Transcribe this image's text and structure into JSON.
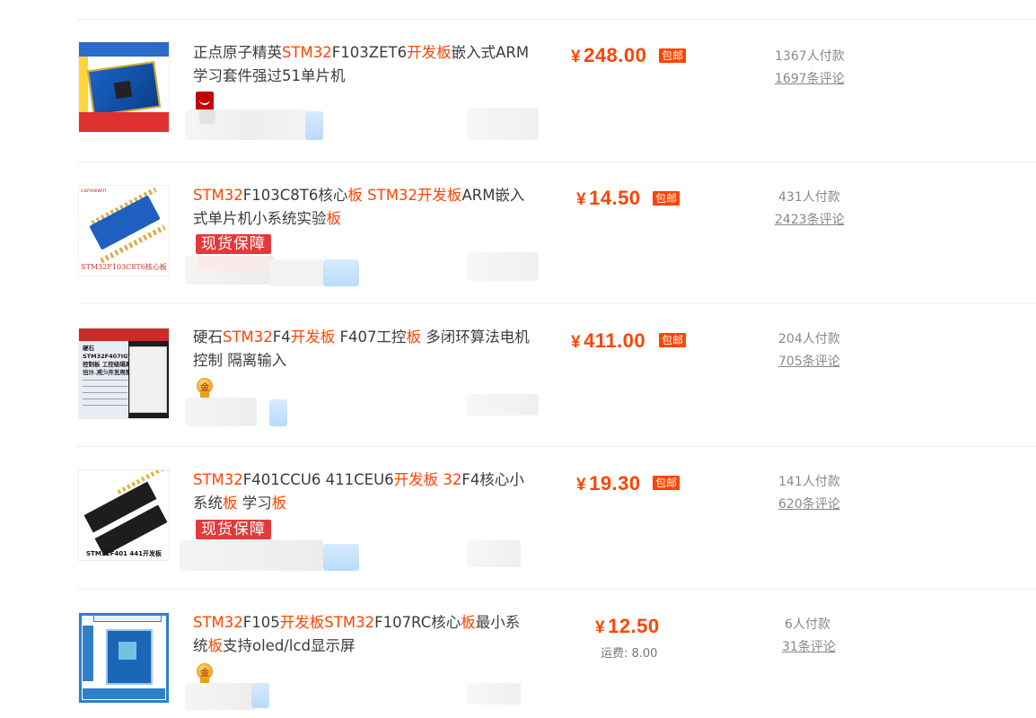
{
  "products": [
    {
      "title_segments": [
        {
          "text": "正点原子精英",
          "hl": false
        },
        {
          "text": "STM32",
          "hl": true
        },
        {
          "text": "F103ZET6",
          "hl": false
        },
        {
          "text": "开发板",
          "hl": true
        },
        {
          "text": "嵌入式ARM学习套件强过51单片机",
          "hl": false
        }
      ],
      "price_symbol": "¥",
      "price": "248.00",
      "free_shipping": "包邮",
      "shipping_fee": null,
      "paid_count": "1367人付款",
      "reviews": "1697条评论",
      "badge": "tmall"
    },
    {
      "title_segments": [
        {
          "text": "STM32",
          "hl": true
        },
        {
          "text": "F103C8T6核心",
          "hl": false
        },
        {
          "text": "板",
          "hl": true
        },
        {
          "text": " ",
          "hl": false
        },
        {
          "text": "STM32开发板",
          "hl": true
        },
        {
          "text": "ARM嵌入式单片机小系统实验",
          "hl": false
        },
        {
          "text": "板",
          "hl": true
        }
      ],
      "price_symbol": "¥",
      "price": "14.50",
      "free_shipping": "包邮",
      "shipping_fee": null,
      "paid_count": "431人付款",
      "reviews": "2423条评论",
      "badge": "现货保障",
      "thumb_caption": "STM32F103C8T6核心板"
    },
    {
      "title_segments": [
        {
          "text": "硬石",
          "hl": false
        },
        {
          "text": "STM32",
          "hl": true
        },
        {
          "text": "F4",
          "hl": false
        },
        {
          "text": "开发板",
          "hl": true
        },
        {
          "text": " F407工控",
          "hl": false
        },
        {
          "text": "板",
          "hl": true
        },
        {
          "text": " 多闭环算法电机控制 隔离输入",
          "hl": false
        }
      ],
      "price_symbol": "¥",
      "price": "411.00",
      "free_shipping": "包邮",
      "shipping_fee": null,
      "paid_count": "204人付款",
      "reviews": "705条评论",
      "badge": "medal",
      "thumb_text": "硬石STM32F407IGT6控制板 工控级隔离设计 减少开发周期"
    },
    {
      "title_segments": [
        {
          "text": "STM32",
          "hl": true
        },
        {
          "text": "F401CCU6 411CEU6",
          "hl": false
        },
        {
          "text": "开发板",
          "hl": true
        },
        {
          "text": " ",
          "hl": false
        },
        {
          "text": "32",
          "hl": true
        },
        {
          "text": "F4核心小系统",
          "hl": false
        },
        {
          "text": "板",
          "hl": true
        },
        {
          "text": " 学习",
          "hl": false
        },
        {
          "text": "板",
          "hl": true
        }
      ],
      "price_symbol": "¥",
      "price": "19.30",
      "free_shipping": "包邮",
      "shipping_fee": null,
      "paid_count": "141人付款",
      "reviews": "620条评论",
      "badge": "现货保障",
      "thumb_caption": "STM32F401 441开发板"
    },
    {
      "title_segments": [
        {
          "text": "STM32",
          "hl": true
        },
        {
          "text": "F105",
          "hl": false
        },
        {
          "text": "开发板STM32",
          "hl": true
        },
        {
          "text": "F107RC核心",
          "hl": false
        },
        {
          "text": "板",
          "hl": true
        },
        {
          "text": "最小系统",
          "hl": false
        },
        {
          "text": "板",
          "hl": true
        },
        {
          "text": "支持oled/lcd显示屏",
          "hl": false
        }
      ],
      "price_symbol": "¥",
      "price": "12.50",
      "free_shipping": null,
      "shipping_fee": "运费: 8.00",
      "paid_count": "6人付款",
      "reviews": "31条评论",
      "badge": "medal"
    }
  ],
  "colors": {
    "accent": "#ff4400",
    "badge_red": "#e4393c",
    "text": "#3c3c3c",
    "muted": "#888888"
  },
  "icons": [
    "tmall-icon",
    "gold-medal-icon"
  ]
}
